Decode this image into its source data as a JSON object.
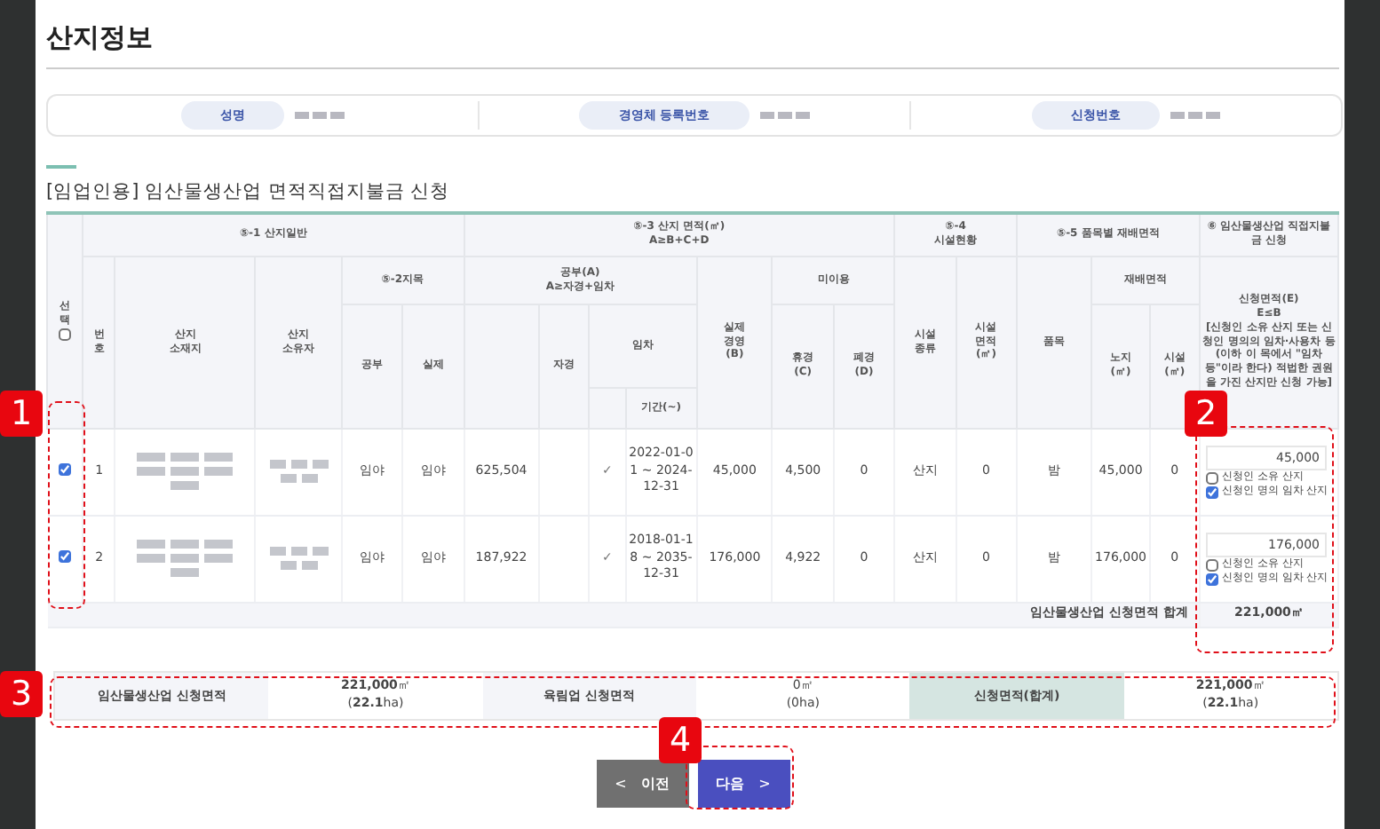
{
  "page_title": "산지정보",
  "info_bar": [
    {
      "label": "성명"
    },
    {
      "label": "경영체 등록번호"
    },
    {
      "label": "신청번호"
    }
  ],
  "section_title": "[임업인용] 임산물생산업 면적직접지불금 신청",
  "headers": {
    "select": "선\n택",
    "select_all_checked": false,
    "general": "⑤-1 산지일반",
    "number": "번\n호",
    "location": "산지\n소재지",
    "owner": "산지\n소유자",
    "land_category": "⑤-2지목",
    "cat_official": "공부",
    "cat_actual": "실제",
    "area": "⑤-3 산지 면적(㎡)\nA≥B+C+D",
    "official_area": "공부(A)\nA≥자경+임차",
    "self_farmed": "자경",
    "lease": "임차",
    "period": "기간(~)",
    "actual_farming": "실제\n경영\n(B)",
    "unused": "미이용",
    "fallow": "휴경\n(C)",
    "abandoned": "폐경\n(D)",
    "facility": "⑤-4\n시설현황",
    "facility_type": "시설\n종류",
    "facility_area": "시설\n면적\n(㎡)",
    "crop_area": "⑤-5 품목별 재배면적",
    "crop": "품목",
    "cultivation_area": "재배면적",
    "open_field": "노지\n(㎡)",
    "greenhouse": "시설\n(㎡)",
    "apply": "⑥ 임산물생산업 직접지불금 신청",
    "apply_area": "신청면적(E)\nE≤B\n[신청인 소유 산지 또는 신청인 명의의 임차·사용차 등(이하 이 목에서 \"임차 등\"이라 한다) 적법한 권원을 가진 산지만 신청 가능]"
  },
  "rows": [
    {
      "checked": true,
      "number": "1",
      "cat_official": "임야",
      "cat_actual": "임야",
      "official_area": "625,504",
      "lease_mark": "✓",
      "period": "2022-01-01 ~ 2024-12-31",
      "actual_farming": "45,000",
      "fallow": "4,500",
      "abandoned": "0",
      "facility_type": "산지",
      "facility_area": "0",
      "crop": "밤",
      "open_field": "45,000",
      "greenhouse": "0",
      "apply_area": "45,000",
      "options": [
        {
          "label": "신청인 소유 산지",
          "checked": false
        },
        {
          "label": "신청인 명의 임차 산지",
          "checked": true
        }
      ]
    },
    {
      "checked": true,
      "number": "2",
      "cat_official": "임야",
      "cat_actual": "임야",
      "official_area": "187,922",
      "lease_mark": "✓",
      "period": "2018-01-18 ~ 2035-12-31",
      "actual_farming": "176,000",
      "fallow": "4,922",
      "abandoned": "0",
      "facility_type": "산지",
      "facility_area": "0",
      "crop": "밤",
      "open_field": "176,000",
      "greenhouse": "0",
      "apply_area": "176,000",
      "options": [
        {
          "label": "신청인 소유 산지",
          "checked": false
        },
        {
          "label": "신청인 명의 임차 산지",
          "checked": true
        }
      ]
    }
  ],
  "total": {
    "label": "임산물생산업 신청면적 합계",
    "value": "221,000㎡"
  },
  "summary": [
    {
      "label": "임산물생산업 신청면적",
      "value": "**221,000**㎡",
      "sub": "(**22.1**ha)",
      "highlight": false
    },
    {
      "label": "육림업 신청면적",
      "value": "0㎡",
      "sub": "(0ha)",
      "highlight": false
    },
    {
      "label": "신청면적(합계)",
      "value": "**221,000**㎡",
      "sub": "(**22.1**ha)",
      "highlight": true
    }
  ],
  "buttons": [
    {
      "kind": "prev",
      "label": "이전",
      "icon": "<"
    },
    {
      "kind": "next",
      "label": "다음",
      "icon": ">"
    }
  ],
  "annotations": [
    "1",
    "2",
    "3",
    "4"
  ]
}
